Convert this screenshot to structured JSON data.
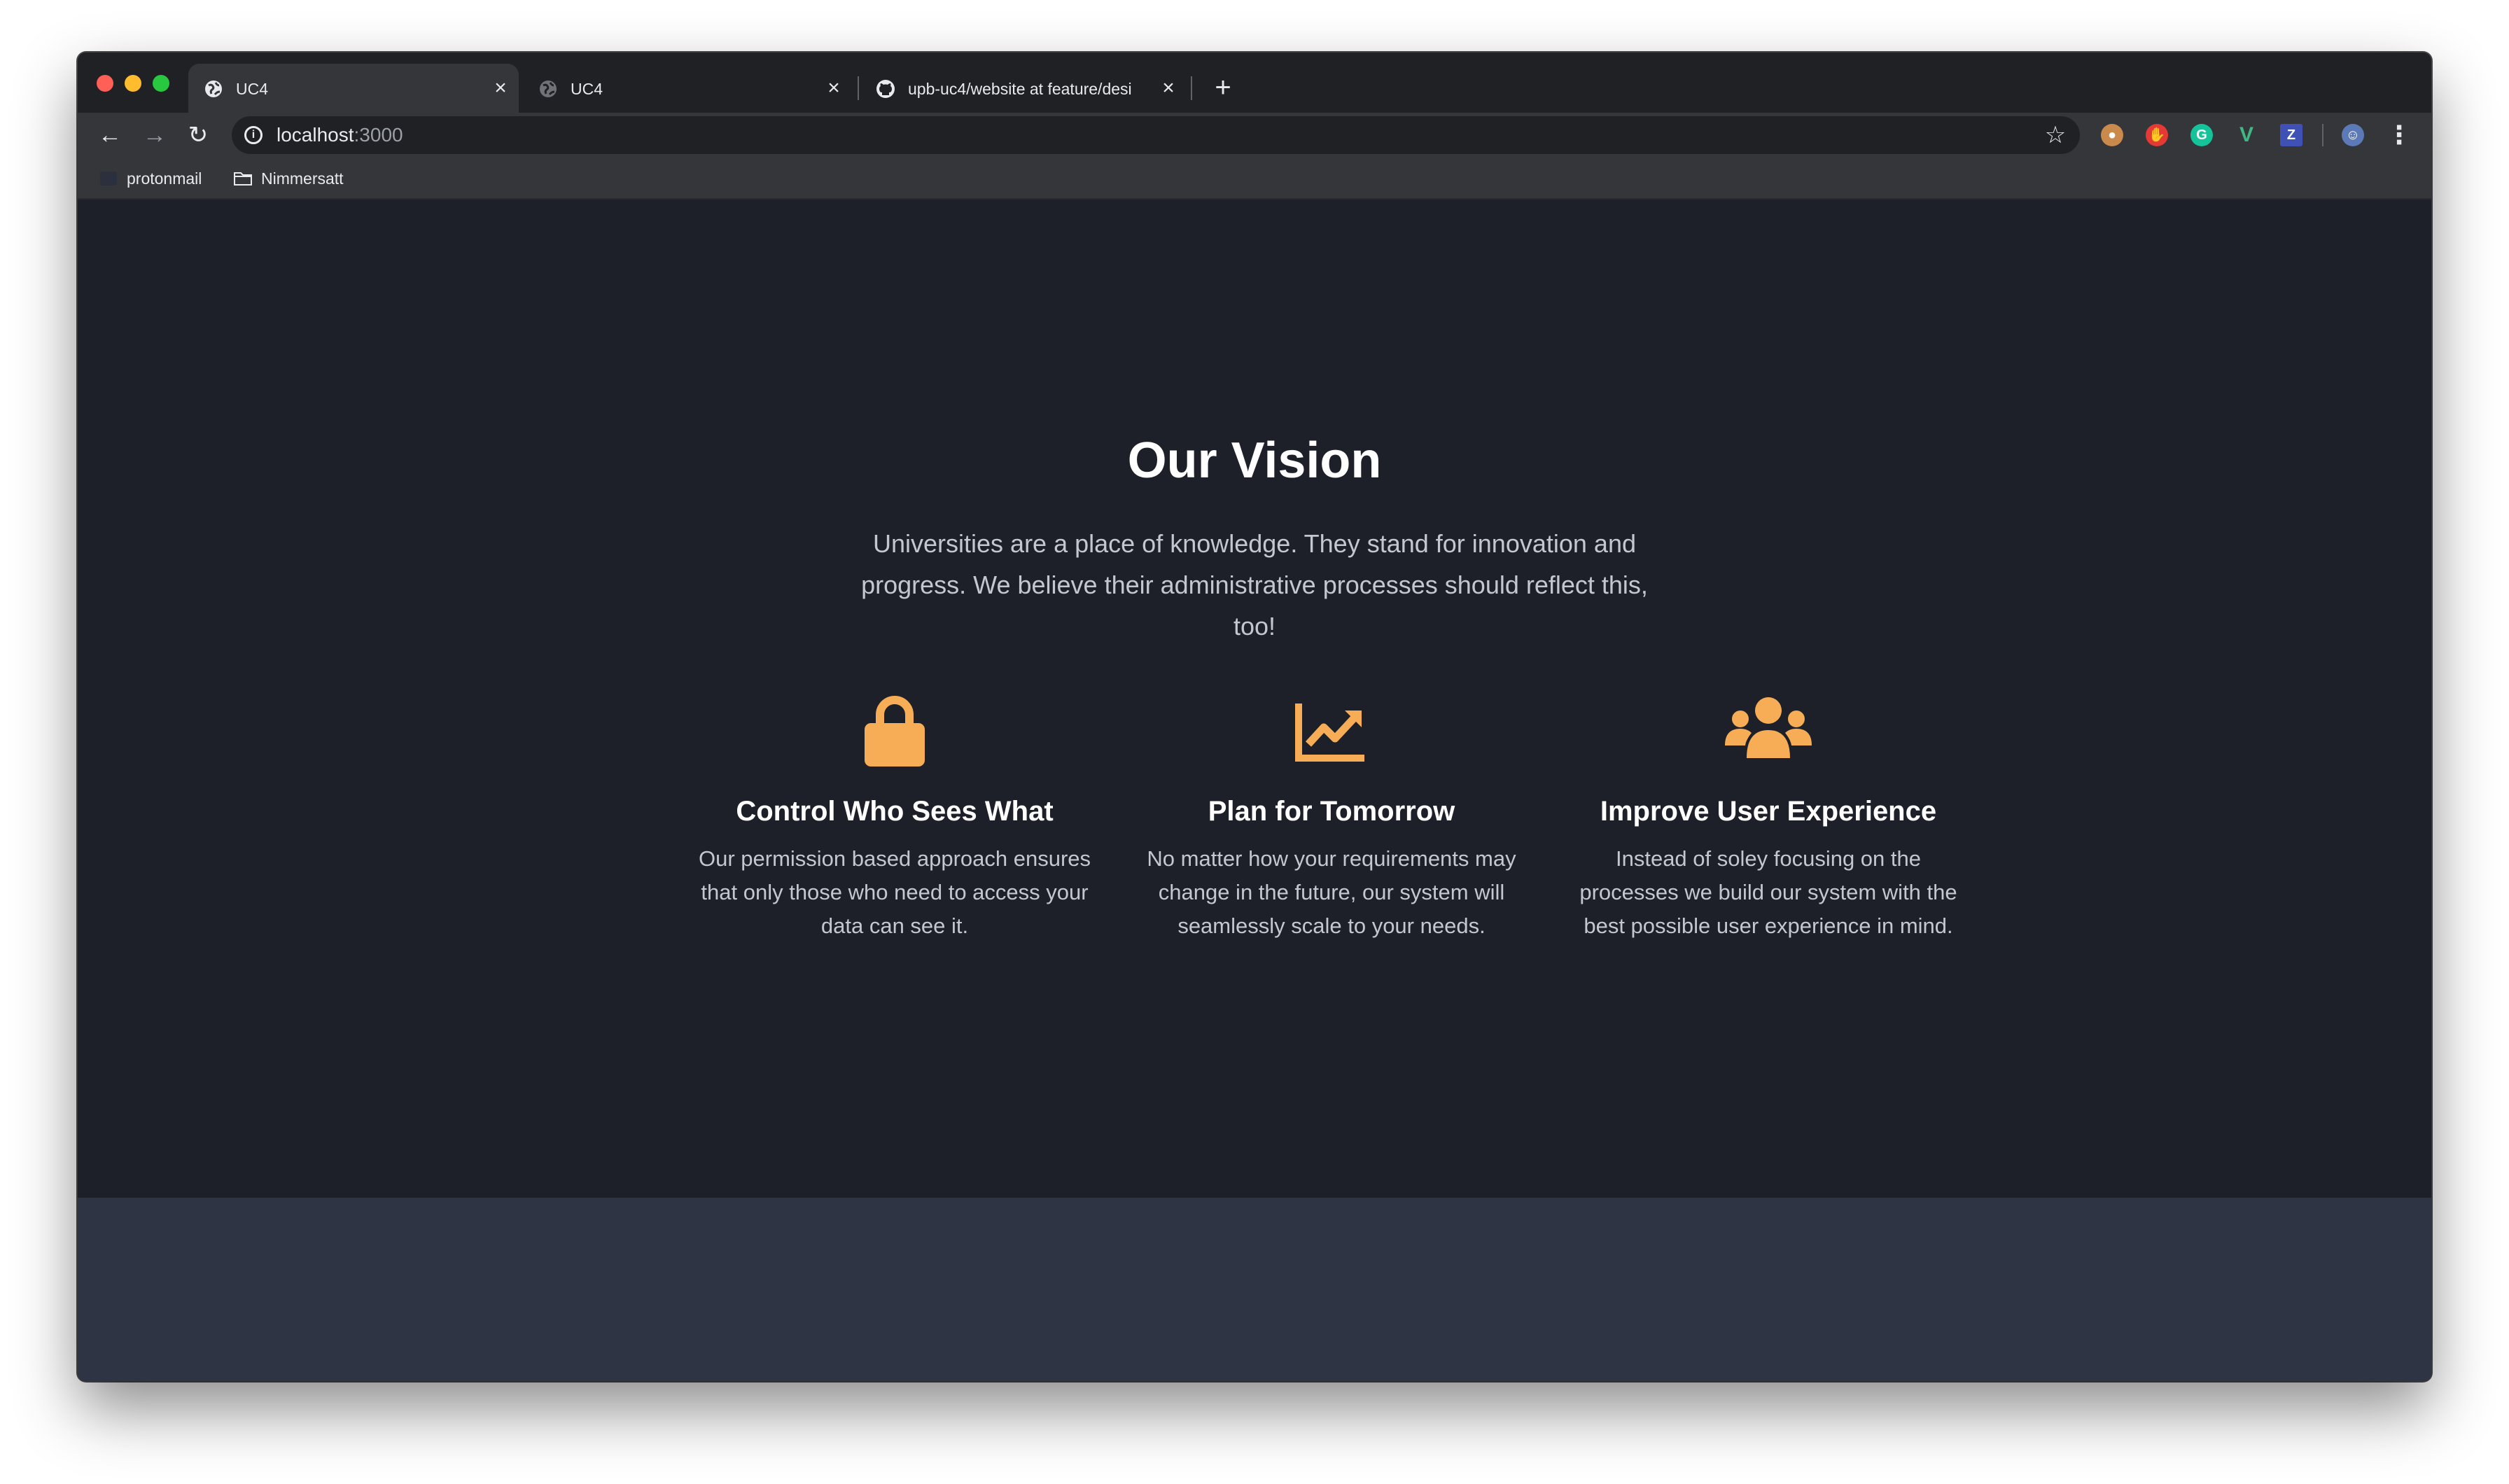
{
  "browser": {
    "tabs": [
      {
        "title": "UC4",
        "active": true,
        "favicon": "globe-icon"
      },
      {
        "title": "UC4",
        "active": false,
        "favicon": "globe-icon"
      },
      {
        "title": "upb-uc4/website at feature/desi",
        "active": false,
        "favicon": "github-icon"
      }
    ],
    "address": {
      "host": "localhost",
      "port": ":3000"
    },
    "bookmarks": [
      {
        "label": "protonmail",
        "icon": "protonmail-icon"
      },
      {
        "label": "Nimmersatt",
        "icon": "folder-icon"
      }
    ],
    "extensions": [
      "cookie-icon",
      "adblock-icon",
      "grammarly-icon",
      "vue-devtools-icon",
      "zotero-icon",
      "profile-icon"
    ],
    "ext_letters": {
      "grammarly": "G",
      "vue": "V",
      "zotero": "Z"
    }
  },
  "vision": {
    "title": "Our Vision",
    "text_line1": "Universities are a place of knowledge. They stand for innovation and",
    "text_line2": "progress. We believe their administrative processes should reflect this, too!"
  },
  "features": [
    {
      "icon": "lock-icon",
      "title": "Control Who Sees What",
      "line1": "Our permission based approach ensures",
      "line2": "that only those who need to access your",
      "line3": "data can see it."
    },
    {
      "icon": "chart-line-icon",
      "title": "Plan for Tomorrow",
      "line1": "No matter how your requirements may",
      "line2": "change in the future, our system will",
      "line3": "seamlessly scale to your needs."
    },
    {
      "icon": "users-icon",
      "title": "Improve User Experience",
      "line1": "Instead of soley focusing on the",
      "line2": "processes we build our system with the",
      "line3": "best possible user experience in mind."
    }
  ],
  "colors": {
    "accent": "#f6ad55",
    "page_bg": "#1d2029",
    "footer_bg": "#2e3444"
  }
}
